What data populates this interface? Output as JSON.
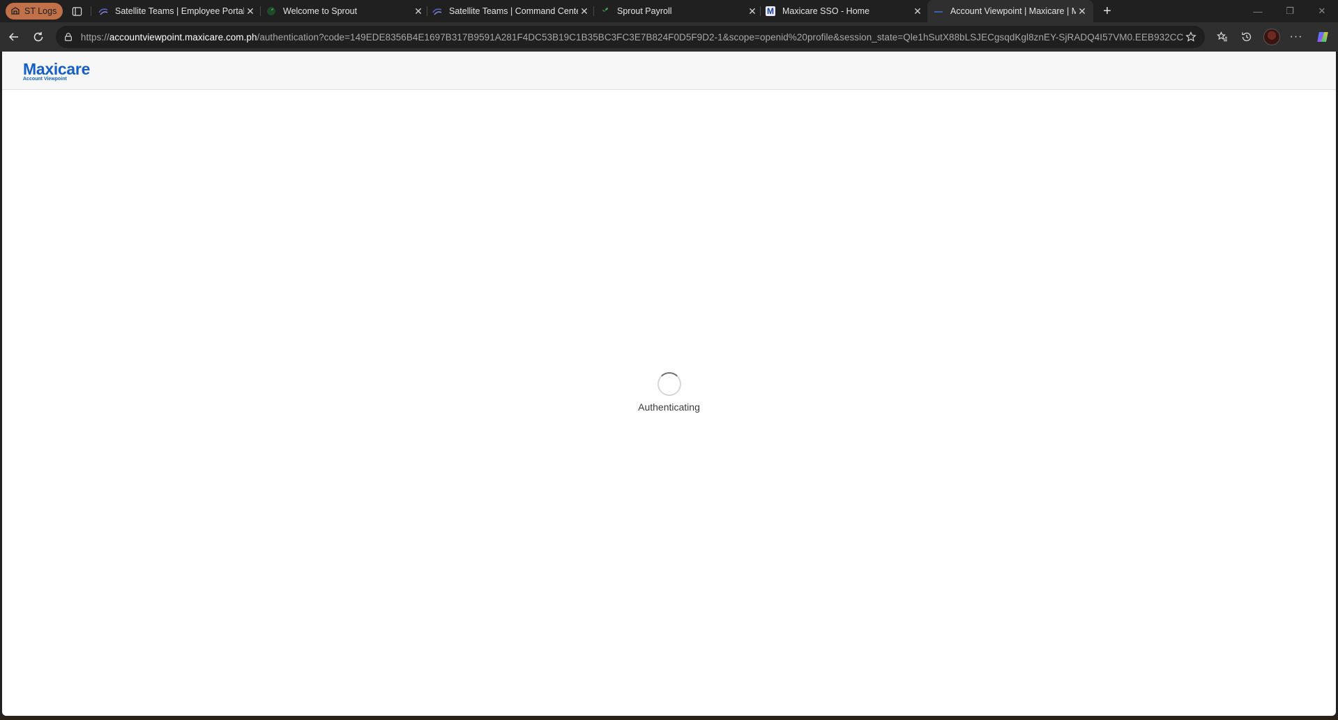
{
  "browser": {
    "profile_label": "ST Logs",
    "tabs": [
      {
        "title": "Satellite Teams | Employee Portal",
        "icon": "satellite-teams-favicon"
      },
      {
        "title": "Welcome to Sprout",
        "icon": "sprout-favicon"
      },
      {
        "title": "Satellite Teams | Command Cente",
        "icon": "satellite-teams-favicon"
      },
      {
        "title": "Sprout Payroll",
        "icon": "sprout-favicon"
      },
      {
        "title": "Maxicare SSO - Home",
        "icon": "maxicare-favicon"
      },
      {
        "title": "Account Viewpoint | Maxicare | M",
        "icon": "maxicare-favicon"
      }
    ],
    "active_tab": 5,
    "url_prefix": "https://",
    "url_host": "accountviewpoint.maxicare.com.ph",
    "url_path": "/authentication?code=149EDE8356B4E1697B317B9591A281F4DC53B19C1B35BC3FC3E7B824F0D5F9D2-1&scope=openid%20profile&session_state=Qle1hSutX88bLSJECgsqdKgl8znEY-SjRADQ4I57VM0.EEB932CC..."
  },
  "page": {
    "logo_main": "Maxicare",
    "logo_sub": "Account Viewpoint",
    "status_text": "Authenticating"
  },
  "colors": {
    "brand_blue": "#1560c8",
    "tab_bar": "#202020",
    "toolbar": "#2f2f2f"
  }
}
